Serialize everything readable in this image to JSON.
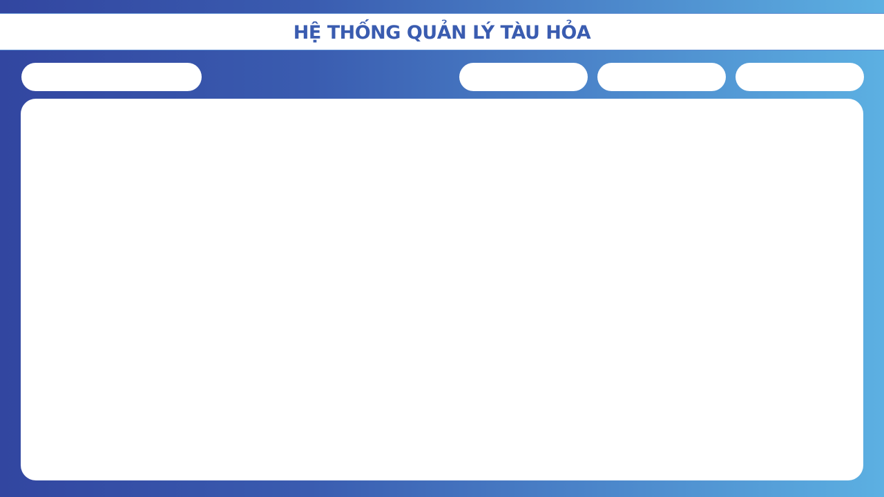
{
  "header": {
    "title": "HỆ THỐNG QUẢN LÝ TÀU HỎA"
  },
  "toolbar": {
    "search_placeholder": "",
    "buttons": [
      {
        "label": ""
      },
      {
        "label": ""
      },
      {
        "label": ""
      }
    ]
  },
  "main": {
    "content": ""
  },
  "colors": {
    "gradient_start": "#3246a0",
    "gradient_end": "#5cb0e2",
    "title_color": "#3a5cb0",
    "panel_background": "#ffffff"
  }
}
